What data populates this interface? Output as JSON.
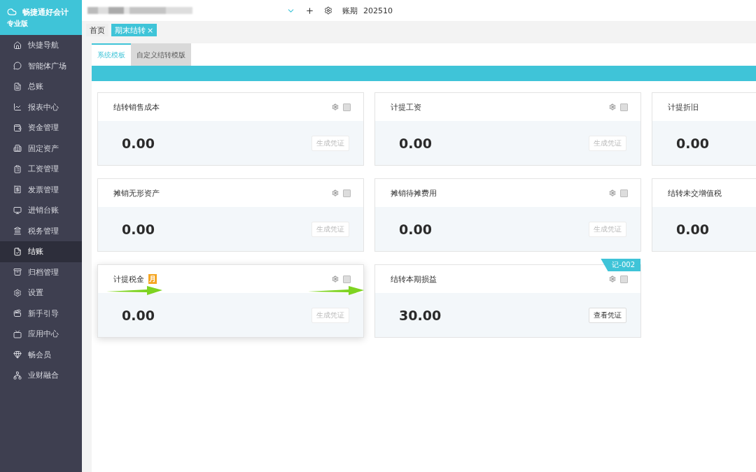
{
  "app": {
    "name": "畅捷通好会计",
    "edition": "专业版"
  },
  "sidebar": {
    "items": [
      {
        "label": "快捷导航",
        "selected": false
      },
      {
        "label": "智能体广场",
        "selected": false
      },
      {
        "label": "总账",
        "selected": false
      },
      {
        "label": "报表中心",
        "selected": false
      },
      {
        "label": "资金管理",
        "selected": false
      },
      {
        "label": "固定资产",
        "selected": false
      },
      {
        "label": "工资管理",
        "selected": false
      },
      {
        "label": "发票管理",
        "selected": false
      },
      {
        "label": "进销台账",
        "selected": false
      },
      {
        "label": "税务管理",
        "selected": false
      },
      {
        "label": "结账",
        "selected": true
      },
      {
        "label": "归档管理",
        "selected": false
      },
      {
        "label": "设置",
        "selected": false
      },
      {
        "label": "新手引导",
        "selected": false
      },
      {
        "label": "应用中心",
        "selected": false
      },
      {
        "label": "畅会员",
        "selected": false
      },
      {
        "label": "业财融合",
        "selected": false
      }
    ]
  },
  "topbar": {
    "period_label": "账期",
    "period": "202510"
  },
  "page_tabs": [
    {
      "label": "首页",
      "selected": false,
      "closable": false
    },
    {
      "label": "期末结转",
      "selected": true,
      "closable": true
    }
  ],
  "close_glyph": "×",
  "template_tabs": [
    {
      "label": "系统模板",
      "selected": true
    },
    {
      "label": "自定义结转模版",
      "selected": false
    }
  ],
  "cards": [
    {
      "title": "结转销售成本",
      "value": "0.00",
      "checked": false,
      "button": {
        "label": "生成凭证",
        "disabled": true
      }
    },
    {
      "title": "计提工资",
      "value": "0.00",
      "checked": false,
      "button": {
        "label": "生成凭证",
        "disabled": true
      }
    },
    {
      "title": "计提折旧",
      "value": "0.00"
    },
    {
      "title": "摊销无形资产",
      "value": "0.00",
      "checked": false,
      "button": {
        "label": "生成凭证",
        "disabled": true
      }
    },
    {
      "title": "摊销待摊费用",
      "value": "0.00",
      "checked": false,
      "button": {
        "label": "生成凭证",
        "disabled": true
      }
    },
    {
      "title": "结转未交增值税",
      "value": "0.00"
    },
    {
      "title": "计提税金",
      "value": "0.00",
      "badge": "月",
      "hovered": true,
      "checked": false,
      "button": {
        "label": "生成凭证",
        "disabled": true
      }
    },
    {
      "title": "结转本期损益",
      "value": "30.00",
      "tag": "记-002",
      "checked": false,
      "button": {
        "label": "查看凭证",
        "disabled": false
      }
    }
  ]
}
